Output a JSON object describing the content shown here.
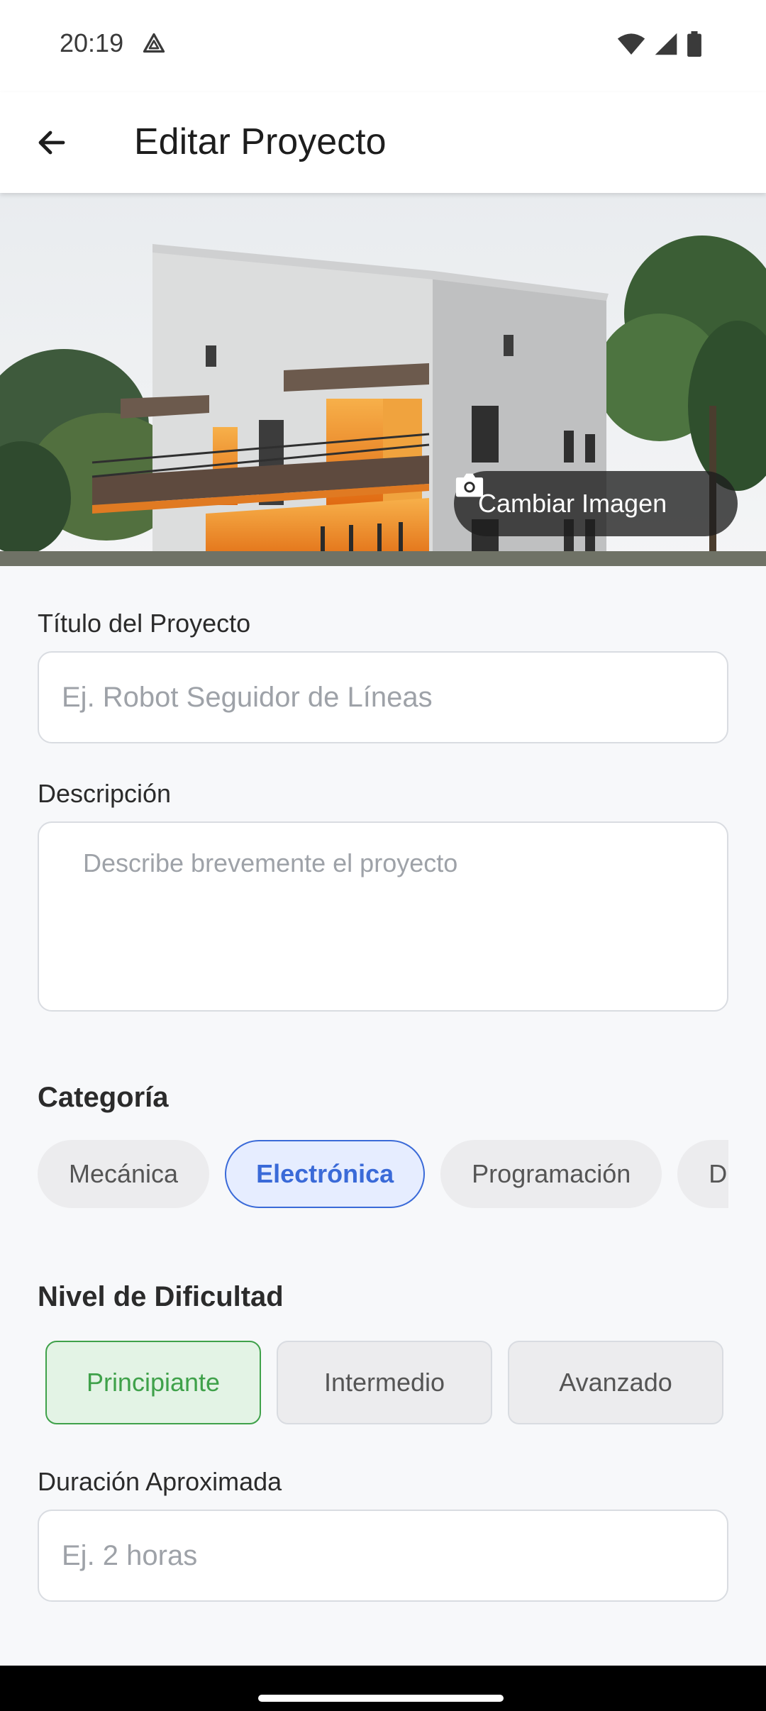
{
  "status_bar": {
    "time": "20:19"
  },
  "app_bar": {
    "title": "Editar Proyecto"
  },
  "hero": {
    "change_image_label": "Cambiar Imagen"
  },
  "form": {
    "title_label": "Título del Proyecto",
    "title_placeholder": "Ej. Robot Seguidor de Líneas",
    "title_value": "",
    "description_label": "Descripción",
    "description_placeholder": "Describe brevemente el proyecto",
    "description_value": "",
    "category_label": "Categoría",
    "categories": [
      "Mecánica",
      "Electrónica",
      "Programación",
      "Dis"
    ],
    "selected_category": "Electrónica",
    "difficulty_label": "Nivel de Dificultad",
    "difficulties": [
      "Principiante",
      "Intermedio",
      "Avanzado"
    ],
    "selected_difficulty": "Principiante",
    "duration_label": "Duración Aproximada",
    "duration_placeholder": "Ej. 2 horas",
    "duration_value": ""
  },
  "colors": {
    "category_active": "#3a6ad8",
    "difficulty_active": "#3fa14a"
  },
  "icons": {
    "back": "arrow-left-icon",
    "camera": "camera-icon",
    "drive": "drive-icon",
    "wifi": "wifi-icon",
    "signal": "signal-icon",
    "battery": "battery-icon"
  }
}
